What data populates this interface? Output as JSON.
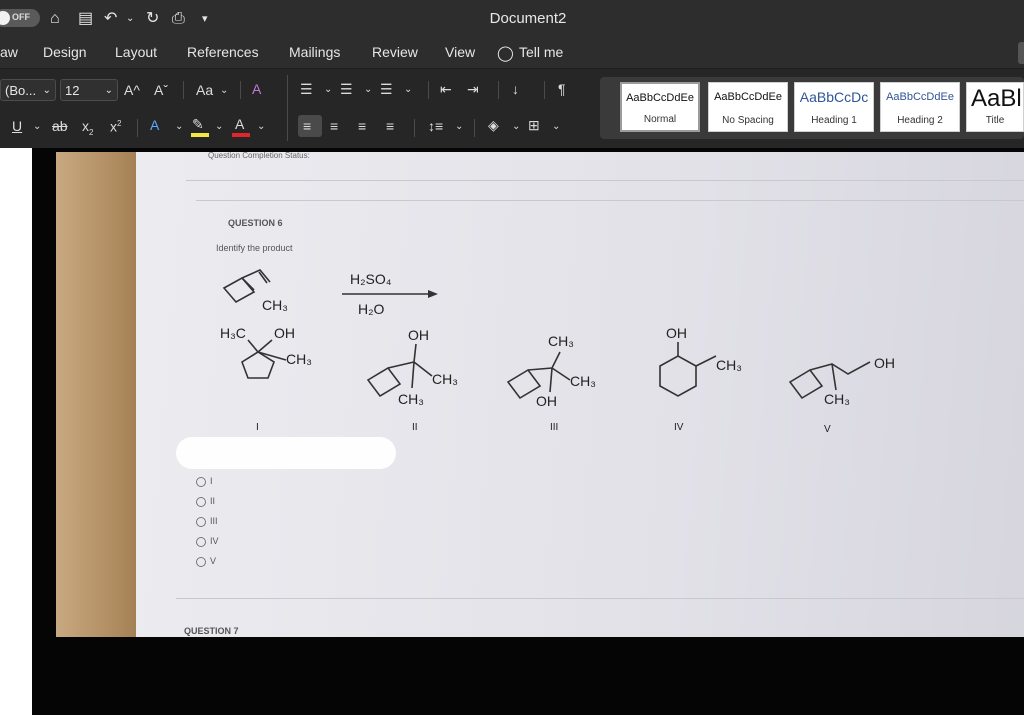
{
  "titlebar": {
    "autosave_label": "OFF",
    "document_title": "Document2"
  },
  "menu": {
    "tabs": [
      "aw",
      "Design",
      "Layout",
      "References",
      "Mailings",
      "Review",
      "View",
      "Tell me"
    ]
  },
  "ribbon": {
    "font_name": "(Bo...",
    "font_size": "12",
    "grow_font": "A^",
    "shrink_font": "Aˇ",
    "change_case": "Aa",
    "styles": [
      {
        "sample": "AaBbCcDdEe",
        "label": "Normal"
      },
      {
        "sample": "AaBbCcDdEe",
        "label": "No Spacing"
      },
      {
        "sample": "AaBbCcDc",
        "label": "Heading 1"
      },
      {
        "sample": "AaBbCcDdEe",
        "label": "Heading 2"
      },
      {
        "sample": "AaBl",
        "label": "Title"
      }
    ]
  },
  "question": {
    "status_header": "Question Completion Status:",
    "number": "QUESTION 6",
    "prompt": "Identify the product",
    "reagent_top": "H₂SO₄",
    "reagent_bottom": "H₂O",
    "start_label": "CH₃",
    "structures": [
      {
        "labels": [
          "H₃C",
          "OH",
          "CH₃"
        ],
        "numeral": "I"
      },
      {
        "labels": [
          "OH",
          "CH₃",
          "CH₃"
        ],
        "numeral": "II"
      },
      {
        "labels": [
          "CH₃",
          "CH₃",
          "OH"
        ],
        "numeral": "III"
      },
      {
        "labels": [
          "OH",
          "CH₃"
        ],
        "numeral": "IV"
      },
      {
        "labels": [
          "OH",
          "CH₃"
        ],
        "numeral": "V"
      }
    ],
    "options": [
      "I",
      "II",
      "III",
      "IV",
      "V"
    ],
    "next_question": "QUESTION 7"
  },
  "colors": {
    "chrome_dark": "#2d2d2d",
    "ribbon_bg": "#262626",
    "style_heading": "#2f5597",
    "highlight_yellow": "#f5e642",
    "font_red": "#e0252b"
  }
}
